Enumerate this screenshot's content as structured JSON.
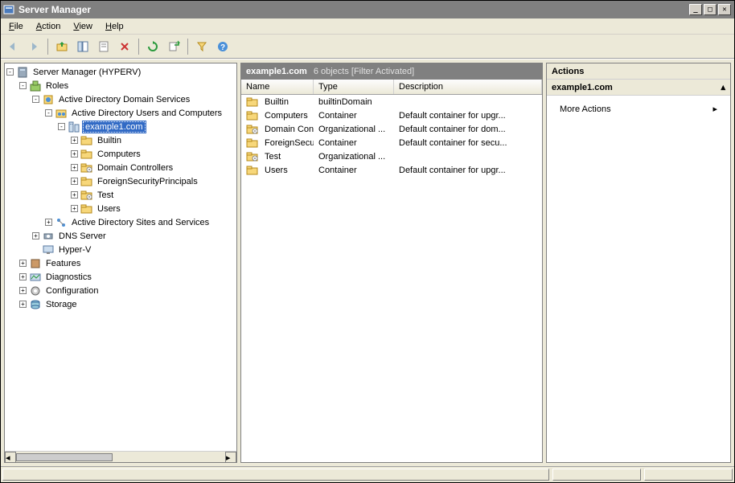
{
  "title": "Server Manager",
  "menubar": [
    "File",
    "Action",
    "View",
    "Help"
  ],
  "toolbar": [
    {
      "name": "back-icon",
      "disabled": true
    },
    {
      "name": "forward-icon",
      "disabled": true
    },
    {
      "name": "up-icon"
    },
    {
      "name": "show-hide-icon"
    },
    {
      "name": "properties-icon",
      "style": "doc"
    },
    {
      "name": "delete-icon",
      "disabled": false,
      "style": "x"
    },
    {
      "name": "refresh-icon"
    },
    {
      "name": "export-icon"
    },
    {
      "name": "filter-icon"
    },
    {
      "name": "help-icon"
    }
  ],
  "tree": {
    "root_label": "Server Manager (HYPERV)",
    "nodes": [
      {
        "indent": 0,
        "twist": "-",
        "icon": "server-icon",
        "label": "Server Manager (HYPERV)"
      },
      {
        "indent": 1,
        "twist": "-",
        "icon": "roles-icon",
        "label": "Roles"
      },
      {
        "indent": 2,
        "twist": "-",
        "icon": "adds-icon",
        "label": "Active Directory Domain Services"
      },
      {
        "indent": 3,
        "twist": "-",
        "icon": "aduc-icon",
        "label": "Active Directory Users and Computers"
      },
      {
        "indent": 4,
        "twist": "-",
        "icon": "domain-icon",
        "label": "example1.com",
        "selected": true
      },
      {
        "indent": 5,
        "twist": "+",
        "icon": "folder-icon",
        "label": "Builtin"
      },
      {
        "indent": 5,
        "twist": "+",
        "icon": "folder-icon",
        "label": "Computers"
      },
      {
        "indent": 5,
        "twist": "+",
        "icon": "ou-icon",
        "label": "Domain Controllers"
      },
      {
        "indent": 5,
        "twist": "+",
        "icon": "folder-icon",
        "label": "ForeignSecurityPrincipals"
      },
      {
        "indent": 5,
        "twist": "+",
        "icon": "ou-icon",
        "label": "Test"
      },
      {
        "indent": 5,
        "twist": "+",
        "icon": "folder-icon",
        "label": "Users"
      },
      {
        "indent": 3,
        "twist": "+",
        "icon": "adss-icon",
        "label": "Active Directory Sites and Services"
      },
      {
        "indent": 2,
        "twist": "+",
        "icon": "dns-icon",
        "label": "DNS Server"
      },
      {
        "indent": 2,
        "twist": " ",
        "icon": "hyperv-icon",
        "label": "Hyper-V"
      },
      {
        "indent": 1,
        "twist": "+",
        "icon": "features-icon",
        "label": "Features"
      },
      {
        "indent": 1,
        "twist": "+",
        "icon": "diag-icon",
        "label": "Diagnostics"
      },
      {
        "indent": 1,
        "twist": "+",
        "icon": "config-icon",
        "label": "Configuration"
      },
      {
        "indent": 1,
        "twist": "+",
        "icon": "storage-icon",
        "label": "Storage"
      }
    ]
  },
  "list": {
    "header_title": "example1.com",
    "header_sub": "6 objects  [Filter Activated]",
    "columns": [
      "Name",
      "Type",
      "Description"
    ],
    "rows": [
      {
        "icon": "folder-icon",
        "name": "Builtin",
        "type": "builtinDomain",
        "desc": ""
      },
      {
        "icon": "folder-icon",
        "name": "Computers",
        "type": "Container",
        "desc": "Default container for upgr..."
      },
      {
        "icon": "ou-icon",
        "name": "Domain Cont...",
        "type": "Organizational ...",
        "desc": "Default container for dom..."
      },
      {
        "icon": "folder-icon",
        "name": "ForeignSecur...",
        "type": "Container",
        "desc": "Default container for secu..."
      },
      {
        "icon": "ou-icon",
        "name": "Test",
        "type": "Organizational ...",
        "desc": ""
      },
      {
        "icon": "folder-icon",
        "name": "Users",
        "type": "Container",
        "desc": "Default container for upgr..."
      }
    ]
  },
  "actions": {
    "header": "Actions",
    "subheader": "example1.com",
    "items": [
      "More Actions"
    ]
  }
}
